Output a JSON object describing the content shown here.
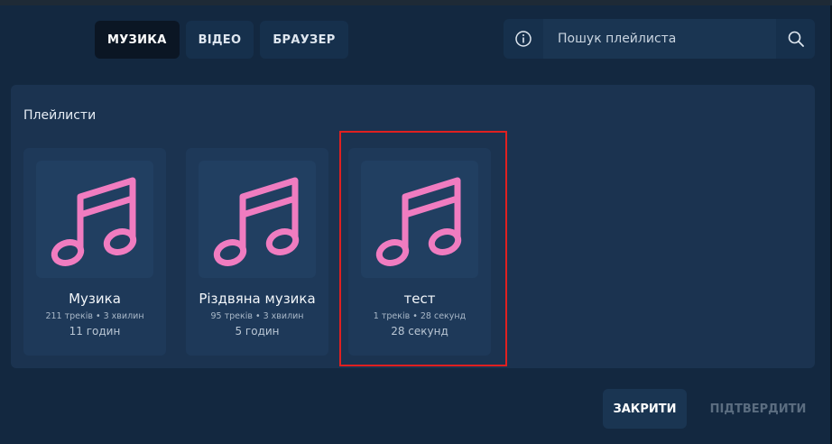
{
  "tabs": [
    {
      "label": "МУЗИКА",
      "active": true
    },
    {
      "label": "ВІДЕО",
      "active": false
    },
    {
      "label": "БРАУЗЕР",
      "active": false
    }
  ],
  "search": {
    "placeholder": "Пошук плейлиста",
    "info_icon": "info-icon",
    "search_icon": "search-icon"
  },
  "section": {
    "title": "Плейлисти"
  },
  "playlists": [
    {
      "name": "Музика",
      "meta": "211 треків • 3 хвилин",
      "duration": "11 годин"
    },
    {
      "name": "Різдвяна музика",
      "meta": "95 треків • 3 хвилин",
      "duration": "5 годин"
    },
    {
      "name": "тест",
      "meta": "1 треків • 28 секунд",
      "duration": "28 секунд"
    }
  ],
  "footer": {
    "close_label": "ЗАКРИТИ",
    "confirm_label": "ПІДТВЕРДИТИ"
  },
  "colors": {
    "accent_note": "#f07cc0",
    "highlight_border": "#e02020"
  }
}
